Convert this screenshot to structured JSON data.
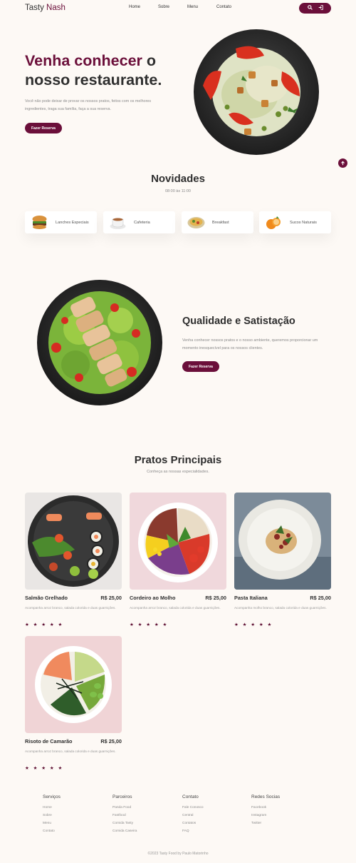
{
  "header": {
    "logo_part1": "Tasty",
    "logo_part2": "Nash",
    "nav": [
      "Home",
      "Sobre",
      "Menu",
      "Contato"
    ],
    "icons": [
      "search-icon",
      "login-icon"
    ]
  },
  "hero": {
    "title_accent": "Venha conhecer",
    "title_rest1": " o",
    "title_rest2": "nosso restaurante.",
    "text": "Você não pode deixar de provar os nossos pratos, feitos com os melhores ingredientes, traga sua família, faça a sua reserva.",
    "button": "Fazer Reserva"
  },
  "novidades": {
    "title": "Novidades",
    "hours": "08:00 às 11:00",
    "categories": [
      {
        "label": "Lanches Especiais",
        "icon": "burger-icon"
      },
      {
        "label": "Cafeteria",
        "icon": "coffee-icon"
      },
      {
        "label": "Breakfast",
        "icon": "breakfast-icon"
      },
      {
        "label": "Sucos Naturais",
        "icon": "orange-juice-icon"
      }
    ]
  },
  "quality": {
    "title": "Qualidade e Satistação",
    "text": "Venha conhecer nossos pratos e o nosso ambiente, queremos proporcionar um momento inesquecível para os nossos clientes.",
    "button": "Fazer Reserva"
  },
  "dishes": {
    "title": "Pratos Principais",
    "subtitle": "Conheça as nossas especialidades.",
    "items": [
      {
        "name": "Salmão Grelhado",
        "price": "R$ 25,00",
        "desc": "Acompanha arroz branco, salada colorida e duas guarnições.",
        "stars": "★ ★ ★ ★ ★"
      },
      {
        "name": "Cordeiro ao Molho",
        "price": "R$ 25,00",
        "desc": "Acompanha arroz branco, salada colorida e duas guarnições.",
        "stars": "★ ★ ★ ★ ★"
      },
      {
        "name": "Pasta Italiana",
        "price": "R$ 25,00",
        "desc": "Acompanha molho branco, salada colorida e duas guarnições.",
        "stars": "★ ★ ★ ★ ★"
      },
      {
        "name": "Risoto de Camarão",
        "price": "R$ 25,00",
        "desc": "Acompanha arroz branco, salada colorida e duas guarnições.",
        "stars": "★ ★ ★ ★ ★"
      }
    ]
  },
  "footer": {
    "columns": [
      {
        "title": "Serviços",
        "links": [
          "Home",
          "Sobre",
          "Menu",
          "Contato"
        ]
      },
      {
        "title": "Parceiros",
        "links": [
          "Panda Food",
          "Fastfood",
          "Comida Tasty",
          "Comida Caseira"
        ]
      },
      {
        "title": "Contato",
        "links": [
          "Fale Conosco",
          "Central",
          "Contatos",
          "FAQ"
        ]
      },
      {
        "title": "Redes Socias",
        "links": [
          "Facebook",
          "Instagram",
          "Twitter"
        ]
      }
    ],
    "copyright": "©2023 Tasty Food by Paulo Matorinho"
  },
  "colors": {
    "accent": "#6b0f3a",
    "background": "#fdf9f5"
  }
}
